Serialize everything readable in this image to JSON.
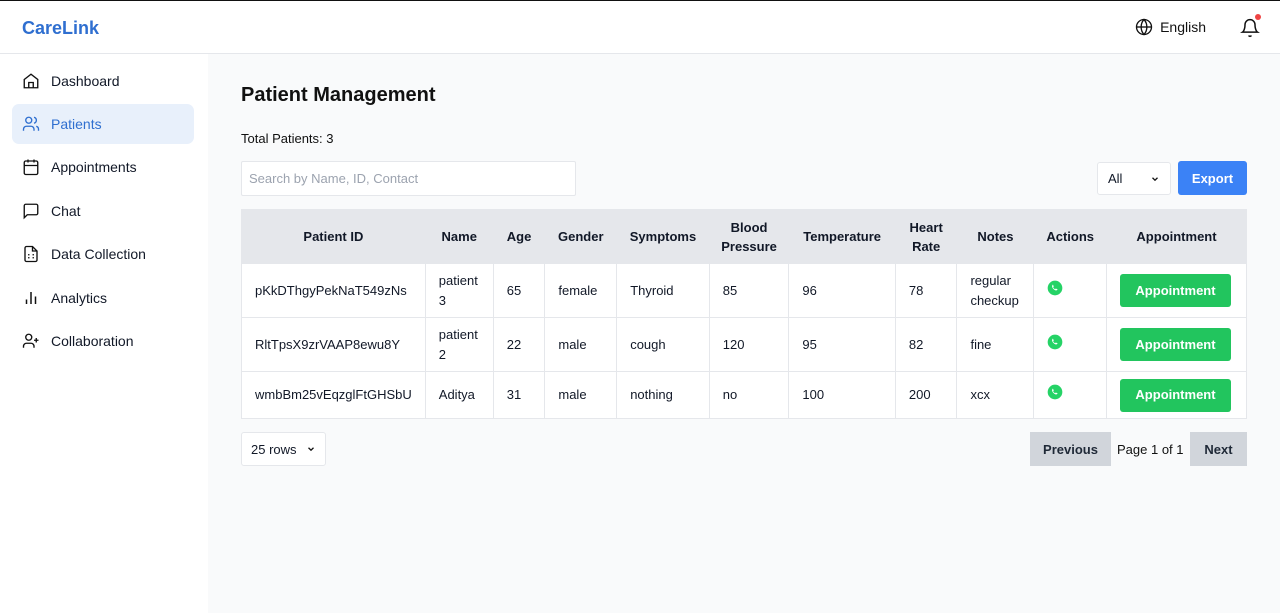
{
  "app": {
    "brand": "CareLink"
  },
  "header": {
    "language": "English"
  },
  "sidebar": {
    "items": [
      {
        "label": "Dashboard",
        "icon": "home-icon"
      },
      {
        "label": "Patients",
        "icon": "users-icon",
        "active": true
      },
      {
        "label": "Appointments",
        "icon": "calendar-icon"
      },
      {
        "label": "Chat",
        "icon": "chat-icon"
      },
      {
        "label": "Data Collection",
        "icon": "file-icon"
      },
      {
        "label": "Analytics",
        "icon": "bar-chart-icon"
      },
      {
        "label": "Collaboration",
        "icon": "user-plus-icon"
      }
    ]
  },
  "main": {
    "title": "Patient Management",
    "total": "Total Patients: 3",
    "search_placeholder": "Search by Name, ID, Contact",
    "filter_value": "All",
    "export_label": "Export"
  },
  "table": {
    "headers": [
      "Patient ID",
      "Name",
      "Age",
      "Gender",
      "Symptoms",
      "Blood Pressure",
      "Temperature",
      "Heart Rate",
      "Notes",
      "Actions",
      "Appointment"
    ],
    "rows": [
      {
        "id": "pKkDThgyPekNaT549zNs",
        "name": "patient 3",
        "age": "65",
        "gender": "female",
        "symptoms": "Thyroid",
        "bp": "85",
        "temp": "96",
        "hr": "78",
        "notes": "regular checkup",
        "appt": "Appointment"
      },
      {
        "id": "RltTpsX9zrVAAP8ewu8Y",
        "name": "patient 2",
        "age": "22",
        "gender": "male",
        "symptoms": "cough",
        "bp": "120",
        "temp": "95",
        "hr": "82",
        "notes": "fine",
        "appt": "Appointment"
      },
      {
        "id": "wmbBm25vEqzglFtGHSbU",
        "name": "Aditya",
        "age": "31",
        "gender": "male",
        "symptoms": "nothing",
        "bp": "no",
        "temp": "100",
        "hr": "200",
        "notes": "xcx",
        "appt": "Appointment"
      }
    ]
  },
  "pagination": {
    "rows_value": "25 rows",
    "previous": "Previous",
    "page_info": "Page 1 of 1",
    "next": "Next"
  },
  "colors": {
    "brand": "#2f6fd0",
    "export": "#3b82f6",
    "appointment": "#22c55e",
    "whatsapp": "#25d366",
    "notification": "#ef4444"
  }
}
